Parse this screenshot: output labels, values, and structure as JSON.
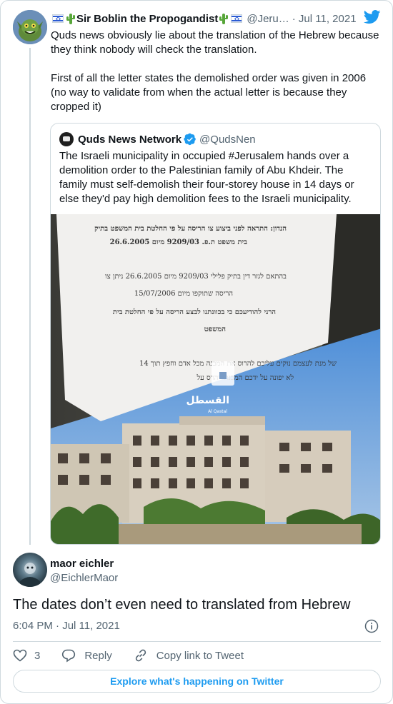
{
  "parent": {
    "name": "Sir Boblin the Propogandist",
    "handle": "@Jeru…",
    "date": "· Jul 11, 2021",
    "text_1": "Quds news obviously lie about the translation of the Hebrew because they think nobody will check the translation.",
    "text_2": "First of all the letter states the demolished order was given in 2006 (no way to validate from when the actual letter is because they cropped it)"
  },
  "quote": {
    "name": "Quds News Network",
    "handle": "@QudsNen",
    "text": "The Israeli municipality in occupied #Jerusalem hands over a demolition order to the Palestinian family of Abu Khdeir. The family must self-demolish their four-storey house in 14 days or else they'd pay high demolition fees to the Israeli municipality.",
    "document": {
      "line_1": "הנדון: התראה לפני ביצוע צו הריסה על פי החלטת בית המשפט בתיק",
      "line_2": "בית משפט ת.פ. 9209/03 מיום 26.6.2005",
      "line_3": "בהתאם לגזר דין בתיק פלילי 9209/03 מיום 26.6.2005 ניתן צו",
      "line_4": "הריסה שתוקפו מיום 15/07/2006",
      "line_5": "הרני להודיעכם כי בכוונתנו לבצע הריסה על פי החלטת בית",
      "line_6": "המשפט",
      "line_7": "של מנת לעצמם נוקים עליכם להרוס את המבנה מכל אדם וחפץ תוך 14",
      "line_8": "לא יפונה על ידכם המבנה ייהרס על"
    },
    "watermark": "القسطل",
    "watermark_sub": "Al Qastal"
  },
  "reply": {
    "name": "maor eichler",
    "handle": "@EichlerMaor",
    "text": "The dates don’t even need to translated from Hebrew",
    "timestamp": "6:04 PM · Jul 11, 2021",
    "likes": "3",
    "reply_label": "Reply",
    "copy_label": "Copy link to Tweet"
  },
  "explore_label": "Explore what's happening on Twitter",
  "colors": {
    "twitter_blue": "#1d9bf0",
    "secondary_text": "#536471",
    "border": "#cfd9de"
  }
}
